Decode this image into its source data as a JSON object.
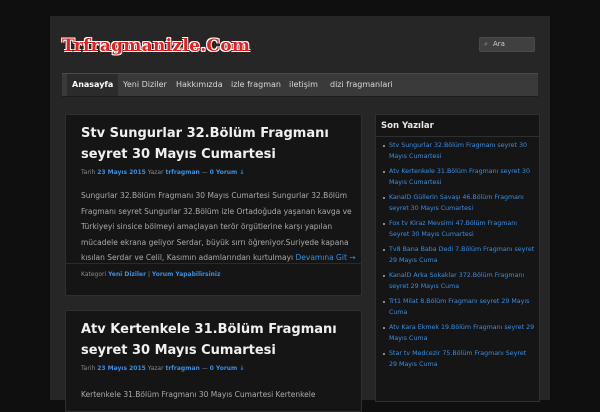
{
  "site": {
    "logo_text": "Trfragmanizle.Com"
  },
  "search": {
    "placeholder": "Ara",
    "icon": "search-icon"
  },
  "nav": {
    "items": [
      {
        "label": "Anasayfa",
        "active": true
      },
      {
        "label": "Yeni Diziler"
      },
      {
        "label": "Hakkımızda"
      },
      {
        "label": "izle fragman"
      },
      {
        "label": "iletişim"
      },
      {
        "label": "dizi fragmanlari"
      }
    ]
  },
  "posts": [
    {
      "title": "Stv Sungurlar 32.Bölüm Fragmanı seyret 30 Mayıs Cumartesi",
      "meta_prefix": "Tarih",
      "date": "23 Mayıs 2015",
      "author_prefix": "Yazar",
      "author": "trfragman",
      "comments": "0 Yorum ↓",
      "excerpt": "Sungurlar 32.Bölüm Fragmanı 30 Mayıs Cumartesi Sungurlar 32.Bölüm Fragmanı seyret Sungurlar 32.Bölüm izle Ortadoğuda yaşanan kavga ve Türkiyeyi sinsice bölmeyi amaçlayan terör örgütlerine karşı yapılan mücadele ekrana geliyor Serdar, büyük sırrı öğreniyor.Suriyede kapana kısılan Serdar ve Celil, Kasımın adamlarından kurtulmayı",
      "more": "Devamına Git →",
      "category_prefix": "Kategori",
      "category": "Yeni Diziler",
      "reply": "Yorum Yapabilirsiniz"
    },
    {
      "title": "Atv Kertenkele 31.Bölüm Fragmanı seyret 30 Mayıs Cumartesi",
      "meta_prefix": "Tarih",
      "date": "23 Mayıs 2015",
      "author_prefix": "Yazar",
      "author": "trfragman",
      "comments": "0 Yorum ↓",
      "excerpt": "Kertenkele 31.Bölüm Fragmanı 30 Mayıs Cumartesi Kertenkele"
    }
  ],
  "sidebar": {
    "title": "Son Yazılar",
    "items": [
      "Stv Sungurlar 32.Bölüm Fragmanı seyret 30 Mayıs Cumartesi",
      "Atv Kertenkele 31.Bölüm Fragmanı seyret 30 Mayıs Cumartesi",
      "KanalD Güllerin Savaşı 46.Bölüm Fragmanı seyret 30 Mayıs Cumartesi",
      "Fox tv Kiraz Mevsimi 47.Bölüm Fragmanı Seyret 30 Mayıs Cumartesi",
      "Tv8 Bana Baba Dedi 7.Bölüm Fragmanı seyret 29 Mayıs Cuma",
      "KanalD Arka Sokaklar 372.Bölüm Fragmanı seyret 29 Mayıs Cuma",
      "Trt1 Milat 8.Bölüm Fragmanı seyret 29 Mayıs Cuma",
      "Atv Kara Ekmek 19.Bölüm Fragmanı seyret 29 Mayıs Cuma",
      "Star tv Medcezir 75.Bölüm Fragmanı Seyret 29 Mayıs Cuma"
    ]
  },
  "colors": {
    "background": "#0f0f0f",
    "panel": "#262626",
    "post_bg": "#151515",
    "logo": "#ef1b1b",
    "link": "#3a8fe0"
  }
}
